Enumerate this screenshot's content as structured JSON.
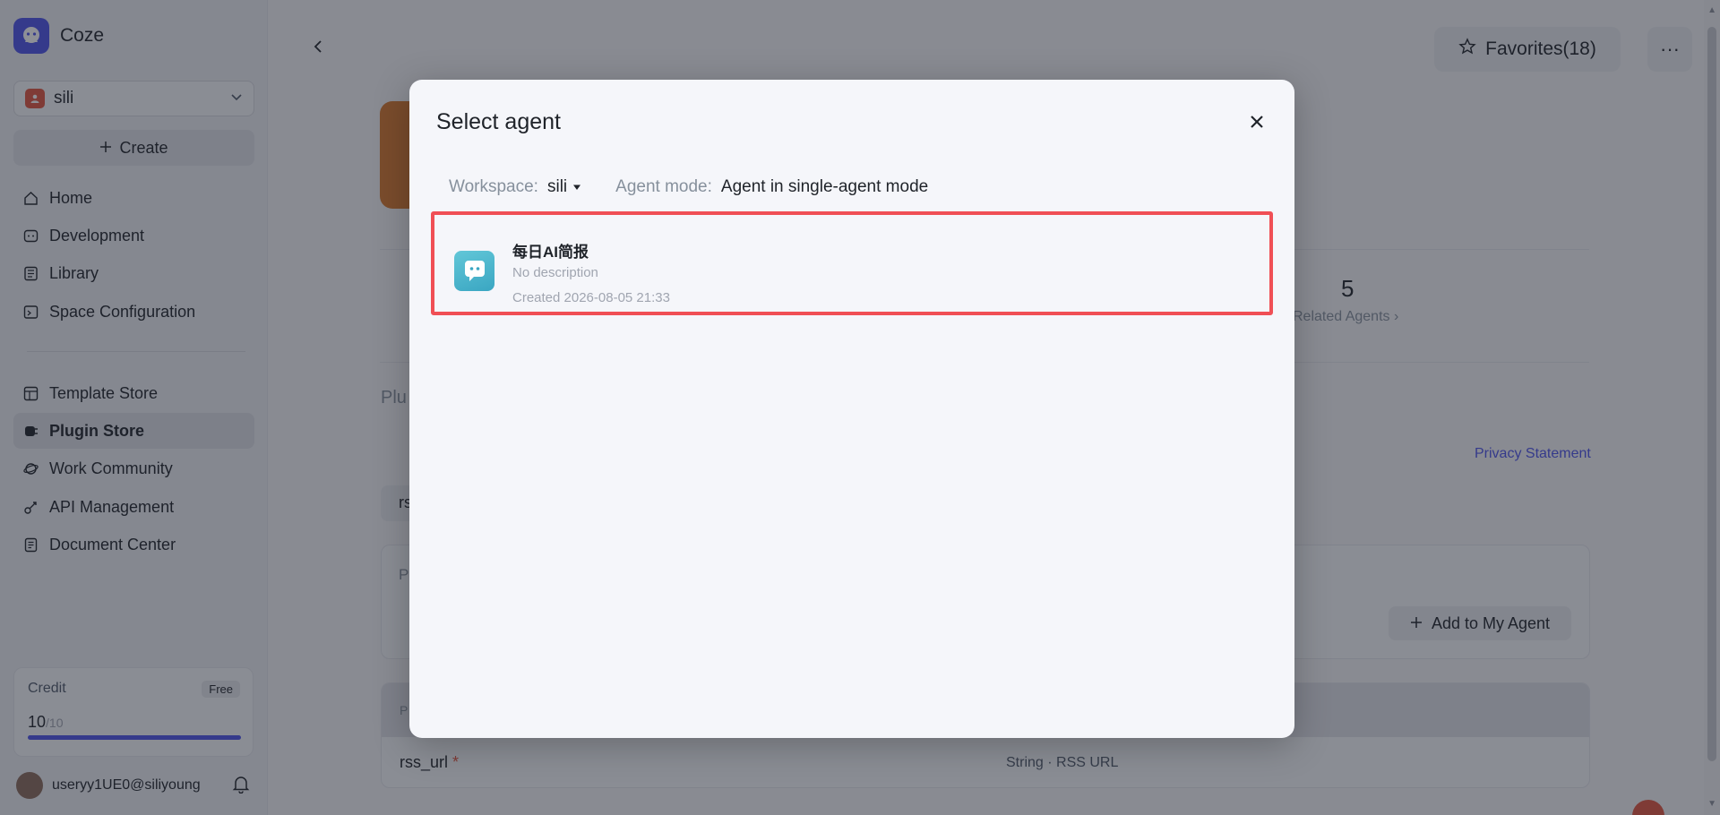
{
  "app": {
    "name": "Coze"
  },
  "sidebar": {
    "workspace": "sili",
    "create_label": "Create",
    "items": [
      {
        "label": "Home",
        "icon": "home-icon"
      },
      {
        "label": "Development",
        "icon": "development-icon"
      },
      {
        "label": "Library",
        "icon": "library-icon"
      },
      {
        "label": "Space Configuration",
        "icon": "space-config-icon"
      },
      {
        "label": "Template Store",
        "icon": "template-store-icon"
      },
      {
        "label": "Plugin Store",
        "icon": "plugin-store-icon",
        "active": true
      },
      {
        "label": "Work Community",
        "icon": "work-community-icon"
      },
      {
        "label": "API Management",
        "icon": "api-management-icon"
      },
      {
        "label": "Document Center",
        "icon": "document-center-icon"
      }
    ],
    "credit": {
      "title": "Credit",
      "badge": "Free",
      "value": "10",
      "total": "/10",
      "fraction": 1.0
    },
    "user": "useryy1UE0@siliyoung"
  },
  "header": {
    "favorites_label": "Favorites(18)",
    "more_label": "···"
  },
  "background": {
    "stat_value": "5",
    "stat_label": "Related Agents",
    "plugin_heading_partial": "Plu",
    "privacy_link": "Privacy Statement",
    "chip_partial": "rs",
    "card_partial": "P",
    "add_agent_label": "Add to My Agent",
    "table_head_partial": "P",
    "param_name": "rss_url",
    "param_required_mark": "*",
    "param_type": "String · RSS URL"
  },
  "modal": {
    "title": "Select agent",
    "workspace_label": "Workspace:",
    "workspace_value": "sili",
    "agent_mode_label": "Agent mode:",
    "agent_mode_value": "Agent in single-agent mode",
    "agents": [
      {
        "name": "每日AI简报",
        "description": "No description",
        "created": "Created 2026-08-05 21:33"
      }
    ]
  },
  "colors": {
    "accent": "#4d53e8",
    "highlight_border": "#f04f55",
    "required": "#e0553f"
  }
}
